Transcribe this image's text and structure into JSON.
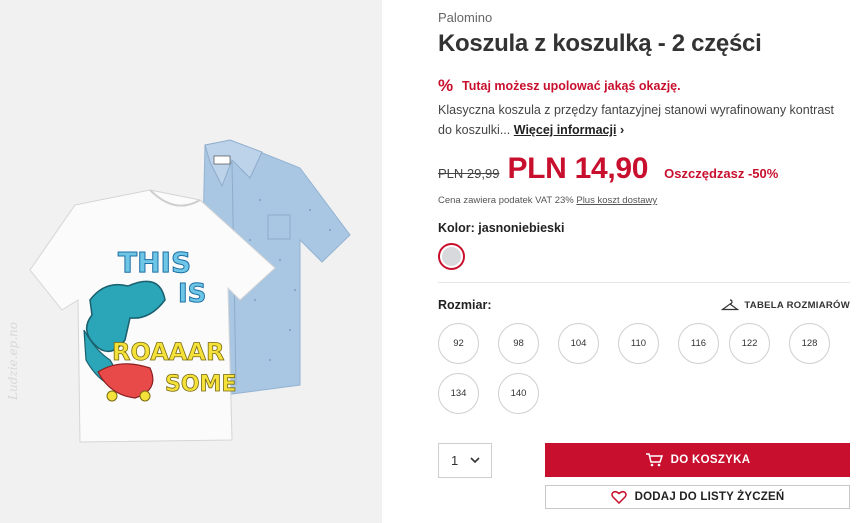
{
  "product": {
    "brand": "Palomino",
    "title": "Koszula z koszulką - 2 części",
    "image_watermark": "Ludzie.ep.no"
  },
  "promo": {
    "icon": "percent-icon",
    "icon_glyph": "%",
    "text": "Tutaj możesz upolować jakąś okazję.",
    "color": "#c8102e"
  },
  "description": {
    "text": "Klasyczna koszula z przędzy fantazyjnej stanowi wyrafinowany kontrast do koszulki...",
    "more_label": "Więcej informacji",
    "more_chevron": "›"
  },
  "price": {
    "old": "PLN 29,99",
    "new": "PLN 14,90",
    "savings": "Oszczędzasz -50%",
    "tax_note": "Cena zawiera podatek VAT 23%",
    "shipping_link": "Plus koszt dostawy"
  },
  "color": {
    "label": "Kolor: jasnoniebieski",
    "selected_swatch": "#d7d9dc"
  },
  "size": {
    "label": "Rozmiar:",
    "table_label": "TABELA ROZMIARÓW",
    "table_icon": "hanger-icon",
    "options": [
      "92",
      "98",
      "104",
      "110",
      "116",
      "122",
      "128",
      "134",
      "140"
    ]
  },
  "quantity": {
    "value": "1",
    "icon": "chevron-down-icon"
  },
  "actions": {
    "add_to_cart": "DO KOSZYKA",
    "cart_icon": "cart-icon",
    "add_to_wishlist": "DODAJ DO LISTY ŻYCZEŃ",
    "wishlist_icon": "heart-icon"
  },
  "colors": {
    "accent": "#c8102e",
    "image_bg": "#f1f1f1"
  }
}
